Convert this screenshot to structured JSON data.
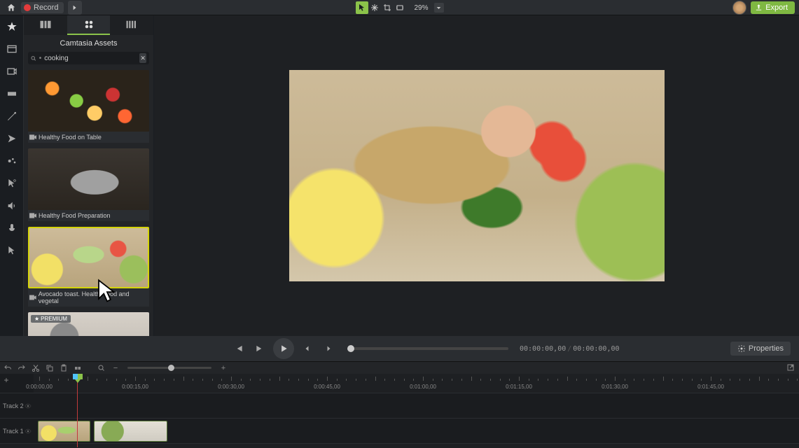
{
  "topbar": {
    "record_label": "Record",
    "zoom_level": "29%",
    "export_label": "Export"
  },
  "media_panel": {
    "title": "Camtasia Assets",
    "search_placeholder": "",
    "search_value": "cooking",
    "assets": [
      {
        "label": "Healthy Food on Table",
        "premium": false
      },
      {
        "label": "Healthy Food Preparation",
        "premium": false
      },
      {
        "label": "Avocado toast. Healthy food and vegetal",
        "premium": false,
        "selected": true
      },
      {
        "label": "",
        "premium": true
      }
    ],
    "premium_badge": "PREMIUM"
  },
  "playback": {
    "current_time": "00:00:00",
    "current_frame": "00",
    "total_time": "00:00:00",
    "total_frame": "00",
    "properties_label": "Properties"
  },
  "timeline": {
    "ruler_marks": [
      "0:00:00,00",
      "0:00:15,00",
      "0:00:30,00",
      "0:00:45,00",
      "0:01:00,00",
      "0:01:15,00",
      "0:01:30,00",
      "0:01:45,00"
    ],
    "tracks": [
      {
        "name": "Track 2"
      },
      {
        "name": "Track 1"
      }
    ]
  }
}
